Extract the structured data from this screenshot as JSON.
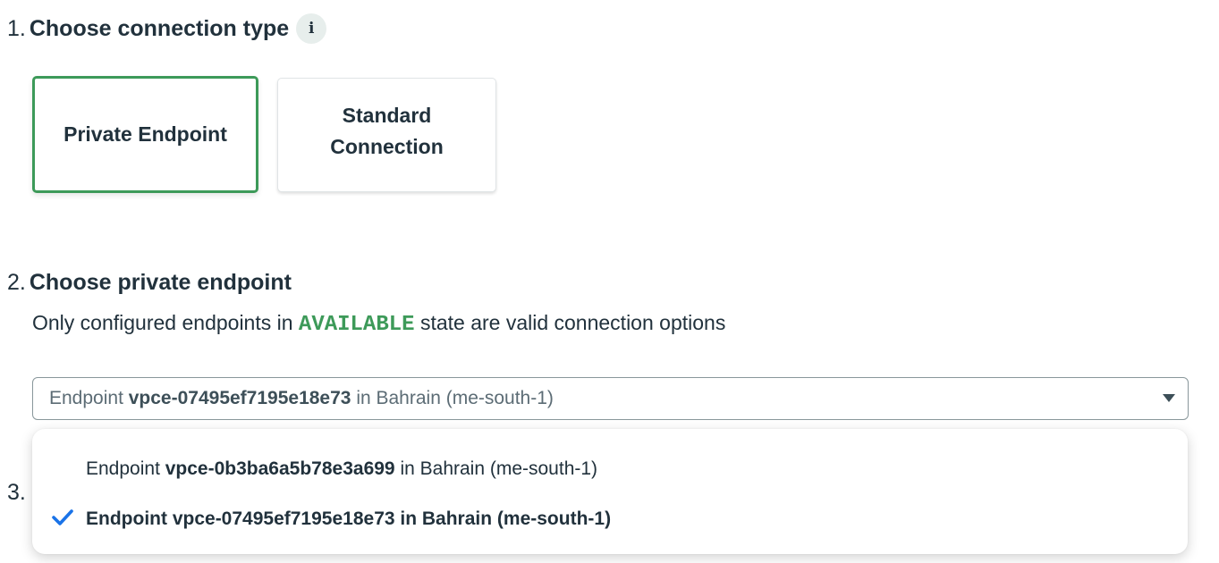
{
  "steps": {
    "s1": {
      "num": "1.",
      "title": "Choose connection type"
    },
    "s2": {
      "num": "2.",
      "title": "Choose private endpoint",
      "desc_prefix": "Only configured endpoints in",
      "desc_state": "AVAILABLE",
      "desc_suffix": "state are valid connection options"
    },
    "s3": {
      "num": "3."
    }
  },
  "connection_types": {
    "private": "Private Endpoint",
    "standard_line1": "Standard",
    "standard_line2": "Connection"
  },
  "select": {
    "prefix": "Endpoint",
    "endpoint_id": "vpce-07495ef7195e18e73",
    "suffix": "in Bahrain (me-south-1)"
  },
  "options": [
    {
      "prefix": "Endpoint",
      "endpoint_id": "vpce-0b3ba6a5b78e3a699",
      "suffix": "in Bahrain (me-south-1)",
      "selected": false
    },
    {
      "prefix": "Endpoint",
      "endpoint_id": "vpce-07495ef7195e18e73",
      "suffix": "in Bahrain (me-south-1)",
      "selected": true
    }
  ],
  "colors": {
    "accent_green": "#3d9a59",
    "check_blue": "#1a73e8"
  },
  "icons": {
    "info": "info-icon",
    "caret": "caret-down-icon",
    "check": "check-icon"
  }
}
